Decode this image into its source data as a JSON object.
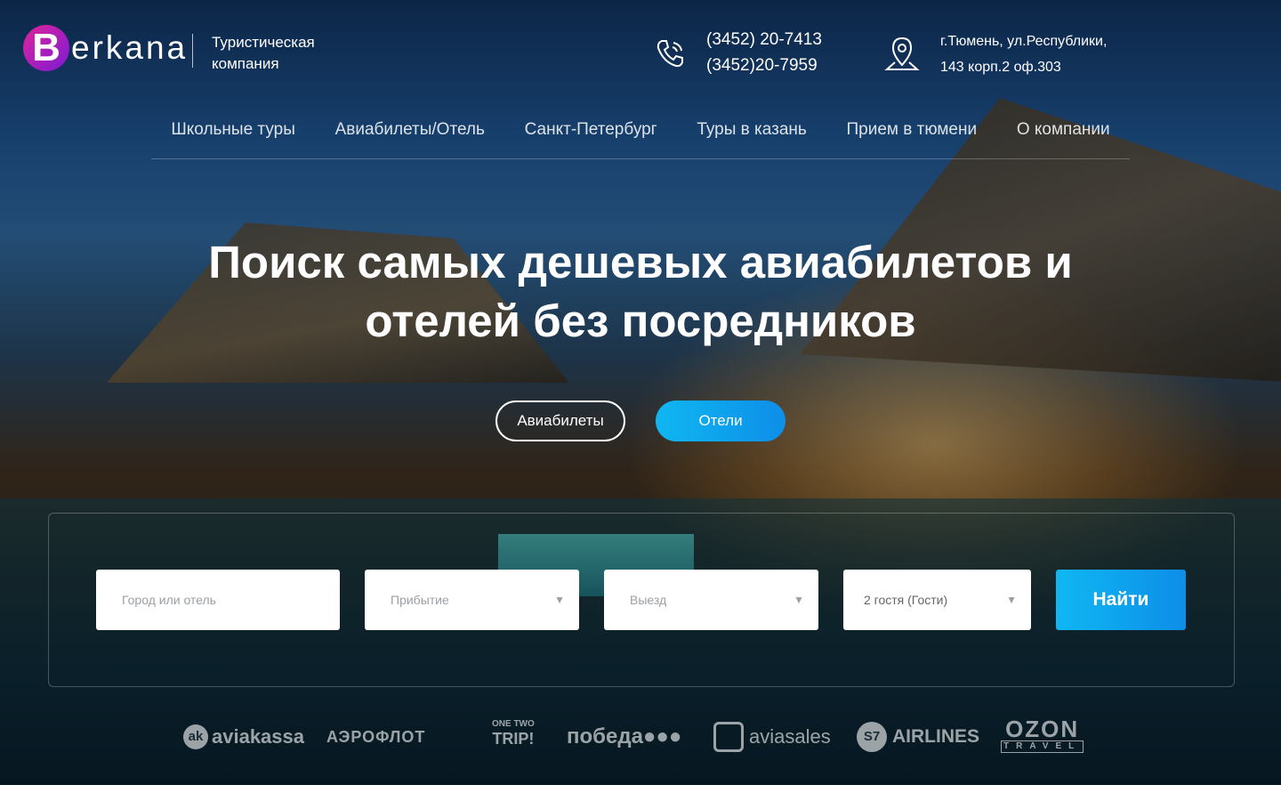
{
  "header": {
    "logo_letter": "B",
    "logo_text": "erkana",
    "tagline_line1": "Туристическая",
    "tagline_line2": "компания",
    "phone1": "(3452) 20-7413",
    "phone2": "(3452)20-7959",
    "address_line1": "г.Тюмень, ул.Республики,",
    "address_line2": "143 корп.2 оф.303"
  },
  "nav": {
    "items": [
      {
        "label": "Школьные туры"
      },
      {
        "label": "Авиабилеты/Отель"
      },
      {
        "label": "Санкт-Петербург"
      },
      {
        "label": "Туры в казань"
      },
      {
        "label": "Прием в тюмени"
      },
      {
        "label": "О компании"
      }
    ]
  },
  "hero": {
    "headline_line1": "Поиск самых дешевых авиабилетов и",
    "headline_line2": "отелей без посредников"
  },
  "tabs": {
    "flights": "Авиабилеты",
    "hotels": "Отели"
  },
  "search": {
    "city_placeholder": "Город или отель",
    "arrival_placeholder": "Прибытие",
    "departure_placeholder": "Выезд",
    "guests_value": "2 гостя (Гости)",
    "find_label": "Найти"
  },
  "partners": {
    "aviakassa": "aviakassa",
    "aviakassa_badge": "ak",
    "aeroflot": "АЭРОФЛОТ",
    "trip_small": "ONE TWO",
    "trip_big": "TRIP!",
    "pobeda": "победа●●●",
    "aviasales": "aviasales",
    "s7_badge": "S7",
    "s7": "AIRLINES",
    "ozon": "OZON",
    "ozon_small": "TRAVEL"
  },
  "colors": {
    "accent_blue": "#0fb7f2",
    "logo_pink": "#e0249a",
    "logo_purple": "#7a1bd6"
  }
}
